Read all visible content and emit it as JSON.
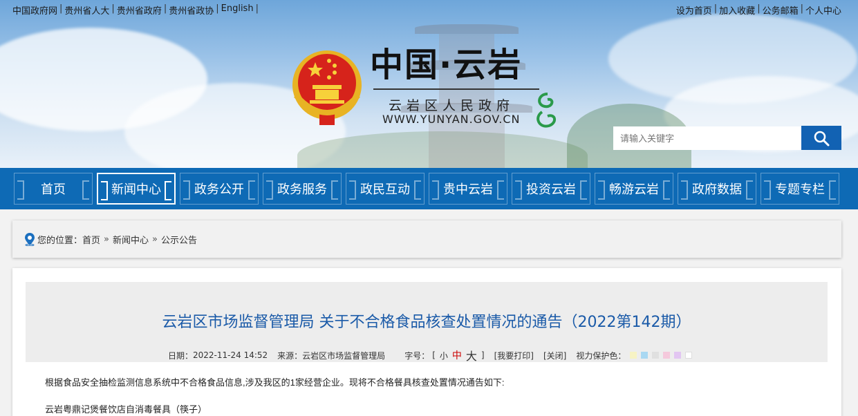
{
  "top_links": {
    "left": [
      "中国政府网",
      "贵州省人大",
      "贵州省政府",
      "贵州省政协",
      "English"
    ],
    "right": [
      "设为首页",
      "加入收藏",
      "公务邮箱",
      "个人中心"
    ],
    "separator": "|"
  },
  "site": {
    "title": "中国·云岩",
    "subtitle": "云岩区人民政府",
    "url": "WWW.YUNYAN.GOV.CN"
  },
  "search": {
    "placeholder": "请输入关键字",
    "icon": "search-icon"
  },
  "nav": {
    "items": [
      "首页",
      "新闻中心",
      "政务公开",
      "政务服务",
      "政民互动",
      "贵中云岩",
      "投资云岩",
      "畅游云岩",
      "政府数据",
      "专题专栏"
    ],
    "active": "新闻中心"
  },
  "breadcrumb": {
    "prefix": "您的位置：",
    "items": [
      "首页",
      "新闻中心",
      "公示公告"
    ],
    "separator": "»"
  },
  "article": {
    "title": "云岩区市场监督管理局 关于不合格食品核查处置情况的通告（2022第142期）",
    "date_label": "日期：",
    "date": "2022-11-24 14:52",
    "source_label": "来源：",
    "source": "云岩区市场监督管理局",
    "font_label": "字号：",
    "bracket_open": "[",
    "bracket_close": "]",
    "font_small": "小",
    "font_medium": "中",
    "font_large": "大",
    "print": "[我要打印]",
    "close": "[关闭]",
    "eye_label": "视力保护色：",
    "eye_colors": [
      "#f7f3c4",
      "#a9d8f2",
      "#e0e0e0",
      "#f5c9dc",
      "#e2c6f2",
      "#ffffff"
    ],
    "para1": "根据食品安全抽检监测信息系统中不合格食品信息,涉及我区的1家经营企业。现将不合格餐具核查处置情况通告如下:",
    "para2": "云岩粤鼎记煲餐饮店自消毒餐具（筷子）"
  },
  "colors": {
    "nav_bg": "#0e6ab5",
    "title_blue": "#1a5aa8",
    "search_btn": "#1262b3"
  }
}
